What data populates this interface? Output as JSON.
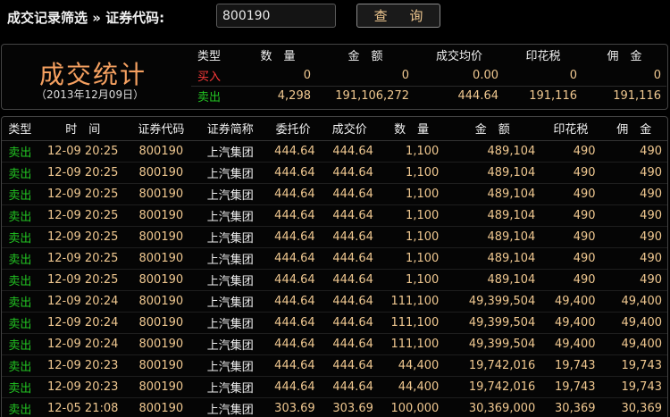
{
  "filter": {
    "label": "成交记录筛选 » 证券代码:",
    "code_value": "800190",
    "query_label": "查 询"
  },
  "summary": {
    "title": "成交统计",
    "date": "（2013年12月09日）",
    "headers": [
      "类型",
      "数　量",
      "金　额",
      "成交均价",
      "印花税",
      "佣　金"
    ],
    "rows": [
      {
        "type": "买入",
        "qty": "0",
        "amount": "0",
        "avg": "0.00",
        "tax": "0",
        "fee": "0"
      },
      {
        "type": "卖出",
        "qty": "4,298",
        "amount": "191,106,272",
        "avg": "444.64",
        "tax": "191,116",
        "fee": "191,116"
      }
    ]
  },
  "detail": {
    "headers": [
      "类型",
      "时　间",
      "证券代码",
      "证券简称",
      "委托价",
      "成交价",
      "数　量",
      "金　额",
      "印花税",
      "佣　金"
    ],
    "rows": [
      {
        "type": "卖出",
        "time": "12-09 20:25",
        "code": "800190",
        "name": "上汽集团",
        "order_price": "444.64",
        "deal_price": "444.64",
        "qty": "1,100",
        "amount": "489,104",
        "tax": "490",
        "fee": "490"
      },
      {
        "type": "卖出",
        "time": "12-09 20:25",
        "code": "800190",
        "name": "上汽集团",
        "order_price": "444.64",
        "deal_price": "444.64",
        "qty": "1,100",
        "amount": "489,104",
        "tax": "490",
        "fee": "490"
      },
      {
        "type": "卖出",
        "time": "12-09 20:25",
        "code": "800190",
        "name": "上汽集团",
        "order_price": "444.64",
        "deal_price": "444.64",
        "qty": "1,100",
        "amount": "489,104",
        "tax": "490",
        "fee": "490"
      },
      {
        "type": "卖出",
        "time": "12-09 20:25",
        "code": "800190",
        "name": "上汽集团",
        "order_price": "444.64",
        "deal_price": "444.64",
        "qty": "1,100",
        "amount": "489,104",
        "tax": "490",
        "fee": "490"
      },
      {
        "type": "卖出",
        "time": "12-09 20:25",
        "code": "800190",
        "name": "上汽集团",
        "order_price": "444.64",
        "deal_price": "444.64",
        "qty": "1,100",
        "amount": "489,104",
        "tax": "490",
        "fee": "490"
      },
      {
        "type": "卖出",
        "time": "12-09 20:25",
        "code": "800190",
        "name": "上汽集团",
        "order_price": "444.64",
        "deal_price": "444.64",
        "qty": "1,100",
        "amount": "489,104",
        "tax": "490",
        "fee": "490"
      },
      {
        "type": "卖出",
        "time": "12-09 20:25",
        "code": "800190",
        "name": "上汽集团",
        "order_price": "444.64",
        "deal_price": "444.64",
        "qty": "1,100",
        "amount": "489,104",
        "tax": "490",
        "fee": "490"
      },
      {
        "type": "卖出",
        "time": "12-09 20:24",
        "code": "800190",
        "name": "上汽集团",
        "order_price": "444.64",
        "deal_price": "444.64",
        "qty": "111,100",
        "amount": "49,399,504",
        "tax": "49,400",
        "fee": "49,400"
      },
      {
        "type": "卖出",
        "time": "12-09 20:24",
        "code": "800190",
        "name": "上汽集团",
        "order_price": "444.64",
        "deal_price": "444.64",
        "qty": "111,100",
        "amount": "49,399,504",
        "tax": "49,400",
        "fee": "49,400"
      },
      {
        "type": "卖出",
        "time": "12-09 20:24",
        "code": "800190",
        "name": "上汽集团",
        "order_price": "444.64",
        "deal_price": "444.64",
        "qty": "111,100",
        "amount": "49,399,504",
        "tax": "49,400",
        "fee": "49,400"
      },
      {
        "type": "卖出",
        "time": "12-09 20:23",
        "code": "800190",
        "name": "上汽集团",
        "order_price": "444.64",
        "deal_price": "444.64",
        "qty": "44,400",
        "amount": "19,742,016",
        "tax": "19,743",
        "fee": "19,743"
      },
      {
        "type": "卖出",
        "time": "12-09 20:23",
        "code": "800190",
        "name": "上汽集团",
        "order_price": "444.64",
        "deal_price": "444.64",
        "qty": "44,400",
        "amount": "19,742,016",
        "tax": "19,743",
        "fee": "19,743"
      },
      {
        "type": "卖出",
        "time": "12-05 21:08",
        "code": "800190",
        "name": "上汽集团",
        "order_price": "303.69",
        "deal_price": "303.69",
        "qty": "100,000",
        "amount": "30,369,000",
        "tax": "30,369",
        "fee": "30,369"
      }
    ]
  },
  "colors": {
    "accent": "#f5a060",
    "buy": "#ff3b3b",
    "sell": "#22c322",
    "numbers": "#f0c890"
  }
}
